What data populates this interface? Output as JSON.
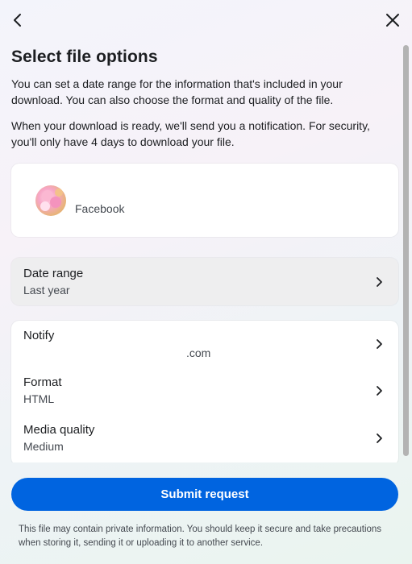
{
  "header": {
    "back_icon": "chevron-left-icon",
    "close_icon": "close-icon"
  },
  "title": "Select file options",
  "description_1": "You can set a date range for the information that's included in your download. You can also choose the format and quality of the file.",
  "description_2": "When your download is ready, we'll send you a notification. For security, you'll only have 4 days to download your file.",
  "profile": {
    "name": "Facebook"
  },
  "date_range": {
    "label": "Date range",
    "value": "Last year"
  },
  "settings": {
    "notify": {
      "label": "Notify",
      "value": ".com"
    },
    "format": {
      "label": "Format",
      "value": "HTML"
    },
    "media_quality": {
      "label": "Media quality",
      "value": "Medium"
    }
  },
  "footer": {
    "submit_label": "Submit request",
    "disclaimer": "This file may contain private information. You should keep it secure and take precautions when storing it, sending it or uploading it to another service."
  },
  "colors": {
    "primary": "#0064e0",
    "text": "#1c1e21",
    "secondary_text": "#444950"
  }
}
